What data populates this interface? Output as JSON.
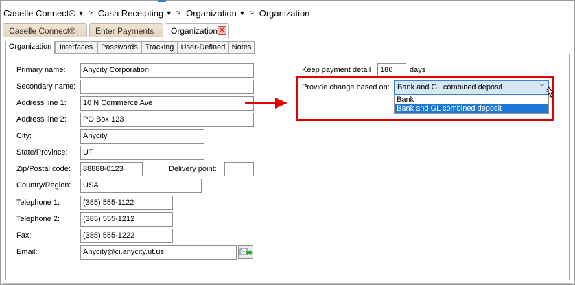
{
  "breadcrumbs": {
    "items": [
      "Caselle Connect®",
      "Cash Receipting",
      "Organization",
      "Organization"
    ],
    "separator": ">"
  },
  "doc_tabs": [
    {
      "label": "Caselle Connect®",
      "active": false
    },
    {
      "label": "Enter Payments",
      "active": false
    },
    {
      "label": "Organization",
      "active": true
    }
  ],
  "sub_tabs": [
    {
      "label": "Organization",
      "active": true
    },
    {
      "label": "Interfaces",
      "active": false
    },
    {
      "label": "Passwords",
      "active": false
    },
    {
      "label": "Tracking",
      "active": false
    },
    {
      "label": "User-Defined",
      "active": false
    },
    {
      "label": "Notes",
      "active": false
    }
  ],
  "form": {
    "primary_name": {
      "label": "Primary name:",
      "value": "Anycity Corporation"
    },
    "secondary_name": {
      "label": "Secondary name:",
      "value": ""
    },
    "address1": {
      "label": "Address line 1:",
      "value": "10 N Commerce Ave"
    },
    "address2": {
      "label": "Address line 2:",
      "value": "PO Box 123"
    },
    "city": {
      "label": "City:",
      "value": "Anycity"
    },
    "state": {
      "label": "State/Province:",
      "value": "UT"
    },
    "zip": {
      "label": "Zip/Postal code:",
      "value": "88888-0123"
    },
    "delivery_point": {
      "label": "Delivery point:",
      "value": ""
    },
    "country": {
      "label": "Country/Region:",
      "value": "USA"
    },
    "telephone1": {
      "label": "Telephone 1:",
      "value": "(385) 555-1122"
    },
    "telephone2": {
      "label": "Telephone 2:",
      "value": "(385) 555-1212"
    },
    "fax": {
      "label": "Fax:",
      "value": "(385) 555-1222"
    },
    "email": {
      "label": "Email:",
      "value": "Anycity@ci.anycity.ut.us"
    }
  },
  "settings": {
    "keep_payment_label": "Keep payment detail",
    "keep_payment_value": "186",
    "keep_payment_unit": "days",
    "provide_change_label": "Provide change based on:",
    "provide_change_value": "Bank and GL combined deposit",
    "options": [
      "Bank",
      "Bank and GL combined deposit"
    ],
    "selected_option_index": 1
  },
  "colors": {
    "highlight_box": "#e00000",
    "selection": "#1e78d6",
    "tab_inactive": "#e9dcc6"
  }
}
